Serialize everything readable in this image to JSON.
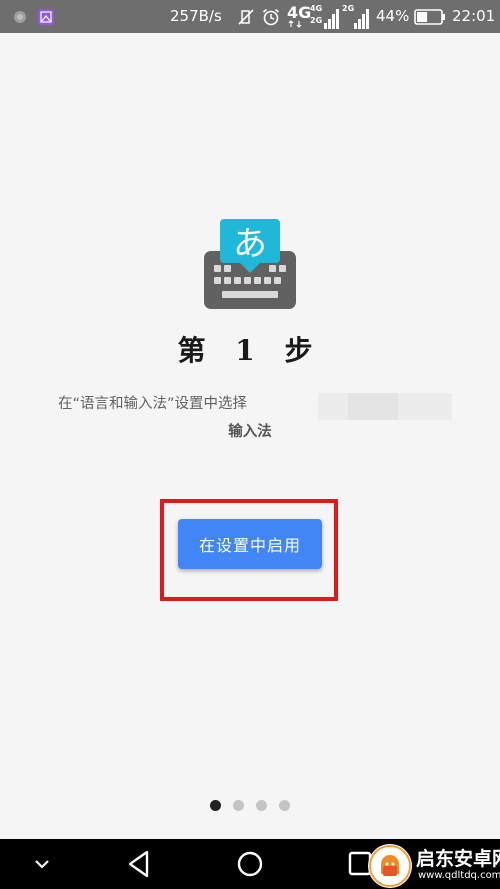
{
  "status_bar": {
    "net_rate": "257B/s",
    "net_type": "4G",
    "sim1_types": [
      "4G",
      "2G"
    ],
    "sim2_type": "2G",
    "battery_percent": "44%",
    "battery_level": 0.44,
    "clock": "22:01",
    "icons": [
      "notification-dot-icon",
      "gallery-icon",
      "vibrate-off-icon",
      "alarm-icon",
      "signal-icon",
      "battery-icon"
    ]
  },
  "onboarding": {
    "step_title": "第 1 步",
    "instruction": "在“语言和输入法”设置中选择",
    "instruction_bold": "输入法",
    "enable_button_label": "在设置中启用",
    "app_icon_glyph": "あ",
    "page_count": 4,
    "current_page": 1
  },
  "navigation_bar": {
    "buttons": [
      "collapse-icon",
      "back-icon",
      "home-icon",
      "recents-icon"
    ]
  },
  "watermark": {
    "title": "启东安卓网",
    "url": "www.qdltdq.com"
  },
  "colors": {
    "status_bar": "#6e6e6e",
    "background": "#f5f5f5",
    "accent": "#4285f4",
    "icon_teal": "#1fb8d8",
    "keyboard_gray": "#616161",
    "highlight_red": "#e01a1a",
    "nav_bar": "#000000"
  }
}
